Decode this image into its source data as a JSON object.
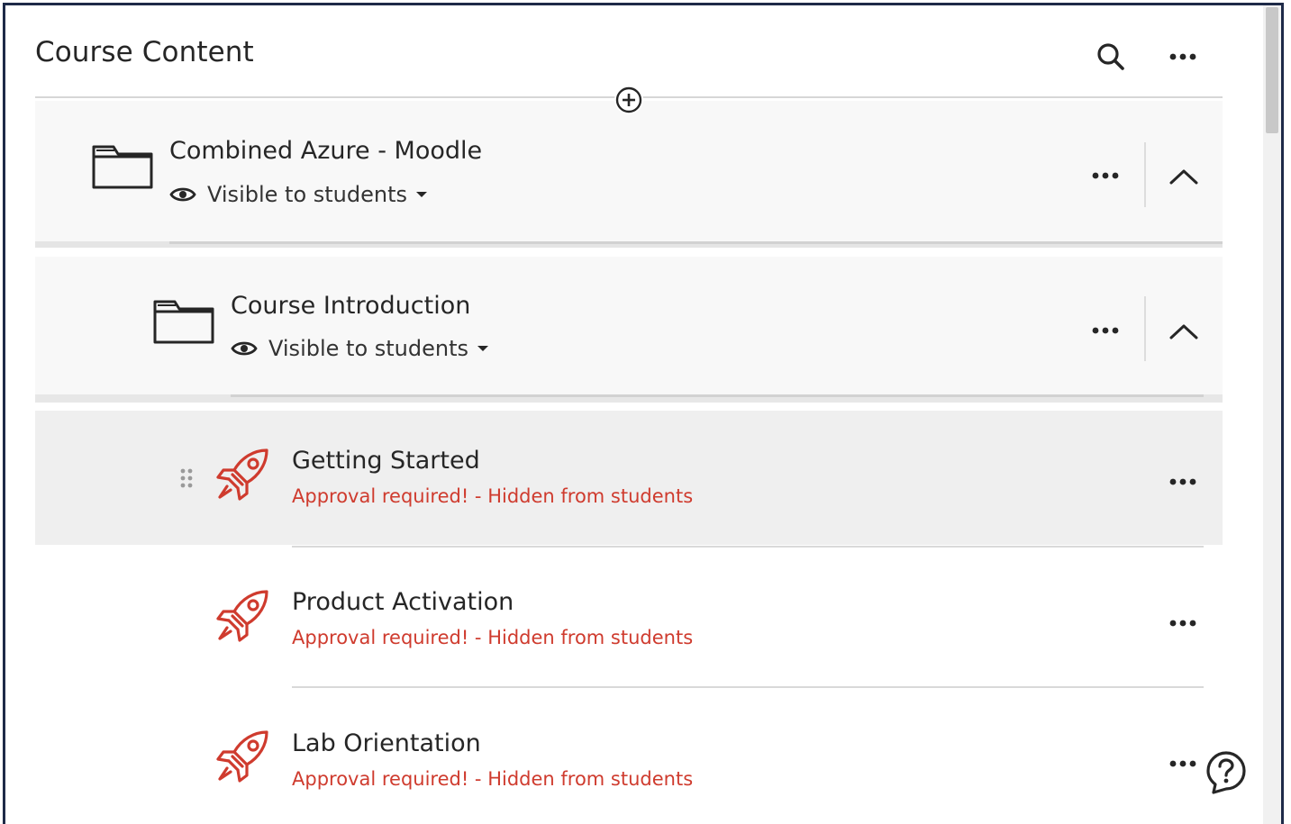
{
  "header": {
    "title": "Course Content",
    "search_icon": "search-icon",
    "more_icon": "ellipsis-icon"
  },
  "folders": [
    {
      "title": "Combined Azure - Moodle",
      "visibility": "Visible to students",
      "icon": "folder-icon",
      "expanded": true
    },
    {
      "title": "Course Introduction",
      "visibility": "Visible to students",
      "icon": "folder-icon",
      "expanded": true
    }
  ],
  "items": [
    {
      "title": "Getting Started",
      "status": "Approval required! - Hidden from students",
      "icon": "rocket-icon"
    },
    {
      "title": "Product Activation",
      "status": "Approval required! - Hidden from students",
      "icon": "rocket-icon"
    },
    {
      "title": "Lab Orientation",
      "status": "Approval required! - Hidden from students",
      "icon": "rocket-icon"
    }
  ],
  "colors": {
    "frame_border": "#1e2a48",
    "status_red": "#cf3b2e",
    "card_bg": "#f8f8f8",
    "hover_bg": "#efefef"
  }
}
